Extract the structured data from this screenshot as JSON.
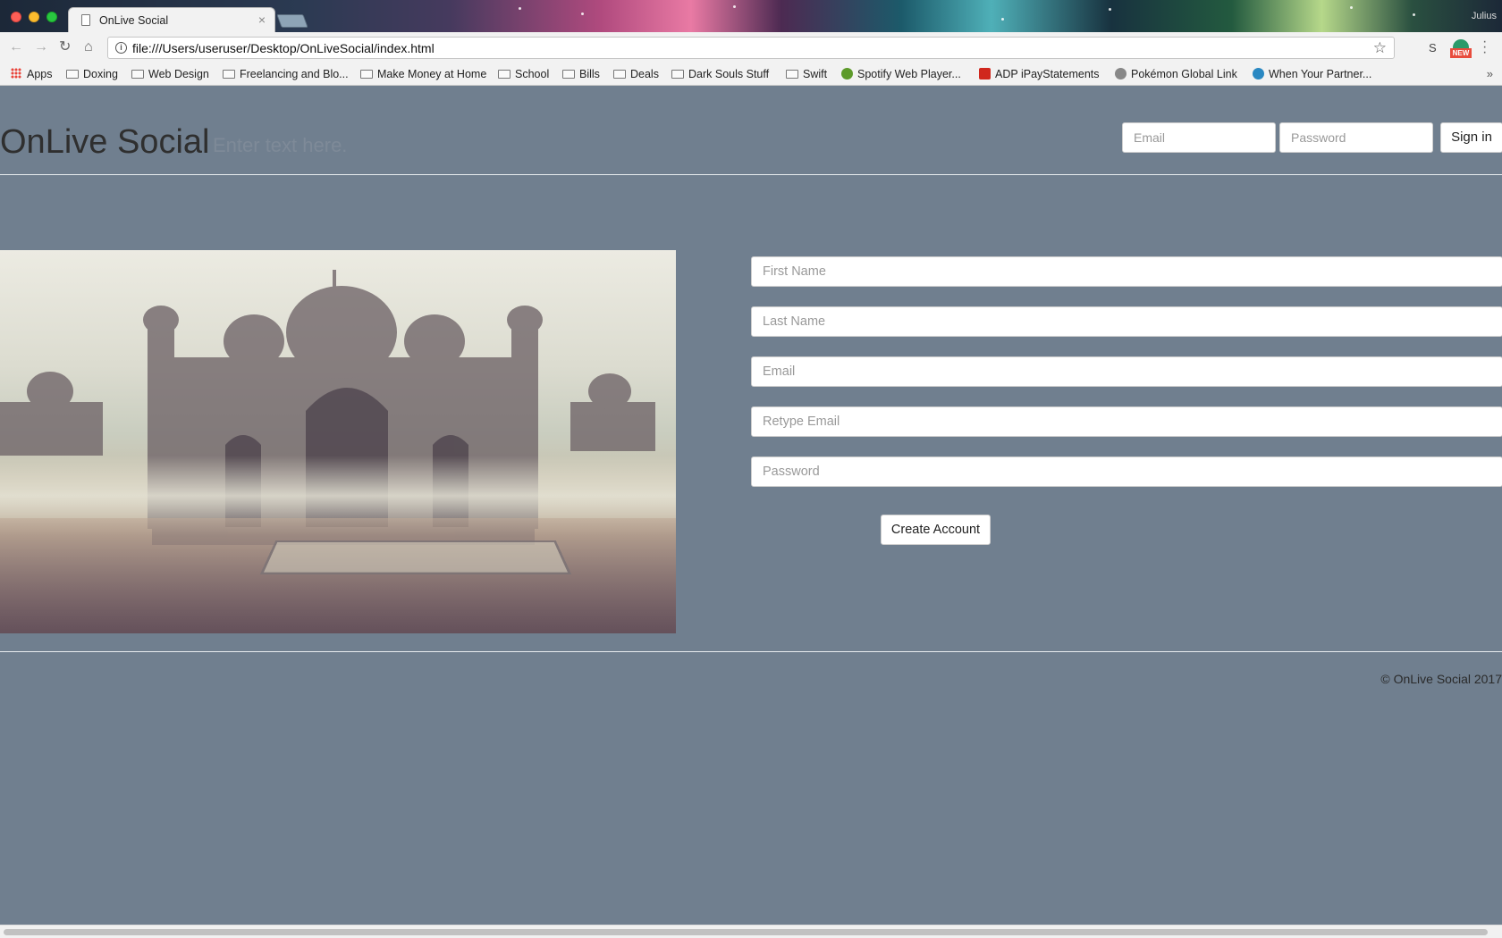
{
  "browser": {
    "tab_title": "OnLive Social",
    "tab_close": "×",
    "url": "file:///Users/useruser/Desktop/OnLiveSocial/index.html",
    "profile_name": "Julius",
    "ext_s_label": "S",
    "ext_badge": "NEW",
    "bookmarks": [
      {
        "label": "Apps",
        "icon": "apps-grid-icon"
      },
      {
        "label": "Doxing",
        "icon": "folder-icon"
      },
      {
        "label": "Web Design",
        "icon": "folder-icon"
      },
      {
        "label": "Freelancing and Blo...",
        "icon": "folder-icon"
      },
      {
        "label": "Make Money at Home",
        "icon": "folder-icon"
      },
      {
        "label": "School",
        "icon": "folder-icon"
      },
      {
        "label": "Bills",
        "icon": "folder-icon"
      },
      {
        "label": "Deals",
        "icon": "folder-icon"
      },
      {
        "label": "Dark Souls Stuff",
        "icon": "folder-icon"
      },
      {
        "label": "Swift",
        "icon": "folder-icon"
      },
      {
        "label": "Spotify Web Player...",
        "icon": "spotify-icon"
      },
      {
        "label": "ADP iPayStatements",
        "icon": "adp-icon"
      },
      {
        "label": "Pokémon Global Link",
        "icon": "pokeball-icon"
      },
      {
        "label": "When Your Partner...",
        "icon": "wordpress-icon"
      }
    ],
    "bookmarks_more": "»"
  },
  "header": {
    "site_title": "OnLive Social",
    "tagline": "Enter text here.",
    "email_placeholder": "Email",
    "password_placeholder": "Password",
    "signin_label": "Sign in"
  },
  "signup": {
    "first_name_placeholder": "First Name",
    "last_name_placeholder": "Last Name",
    "email_placeholder": "Email",
    "retype_email_placeholder": "Retype Email",
    "password_placeholder": "Password",
    "create_label": "Create Account"
  },
  "footer": {
    "copyright": "© OnLive Social 2017"
  },
  "colors": {
    "page_background": "#707f8f",
    "divider": "#e8ecef"
  }
}
